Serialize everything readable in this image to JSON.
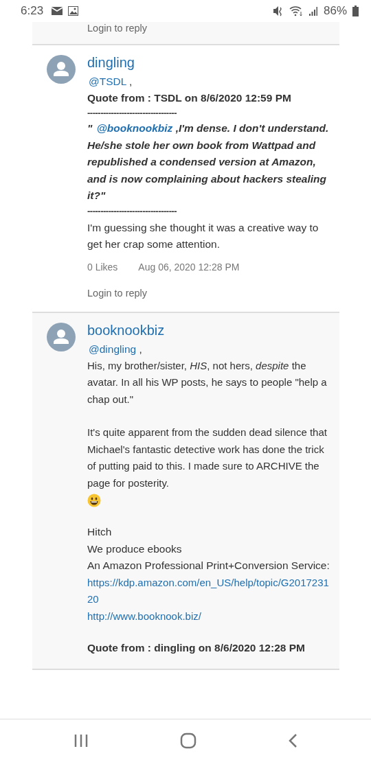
{
  "status_bar": {
    "time": "6:23",
    "battery": "86%"
  },
  "posts": [
    {
      "kind": "fragment",
      "login": "Login to reply"
    },
    {
      "kind": "post",
      "author": "dingling",
      "mention": {
        "name": "@TSDL",
        "after": ","
      },
      "blocks": [
        {
          "kind": "quote_header",
          "text": "Quote from : TSDL on 8/6/2020 12:59 PM"
        },
        {
          "kind": "divider",
          "text": "----------------------------------"
        },
        {
          "kind": "quote",
          "open": "\" ",
          "mention": "@booknookbiz",
          "text": " ,I'm dense. I don't understand. He/she stole her own book from Wattpad and republished a condensed version at Amazon, and is now complaining about hackers stealing it?\""
        },
        {
          "kind": "divider",
          "text": "----------------------------------"
        },
        {
          "kind": "text",
          "text": " I'm guessing she thought it was a creative way to get her crap some attention."
        }
      ],
      "likes": "0 Likes",
      "date": "Aug 06, 2020 12:28 PM",
      "login": "Login to reply"
    },
    {
      "kind": "post",
      "author": "booknookbiz",
      "mention": {
        "name": "@dingling",
        "after": ","
      },
      "blocks": [
        {
          "kind": "paragraph",
          "text": "His, my brother/sister, *HIS*, not hers, *despite* the avatar. In all his WP posts, he says to people \"help a chap out.\""
        },
        {
          "kind": "paragraph",
          "text": "It's quite apparent from the sudden dead silence that Michael's fantastic detective work has done the trick of putting paid to this. I made sure to ARCHIVE the page for posterity.",
          "emoji": true
        },
        {
          "kind": "line",
          "text": "Hitch"
        },
        {
          "kind": "line",
          "text": "We produce ebooks"
        },
        {
          "kind": "line",
          "text": "An Amazon Professional Print+Conversion Service:"
        },
        {
          "kind": "link",
          "text": "https://kdp.amazon.com/en_US/help/topic/G201723120"
        },
        {
          "kind": "link",
          "text": "http://www.booknook.biz/"
        },
        {
          "kind": "quote_header",
          "text": "Quote from : dingling on 8/6/2020 12:28 PM"
        }
      ]
    }
  ]
}
